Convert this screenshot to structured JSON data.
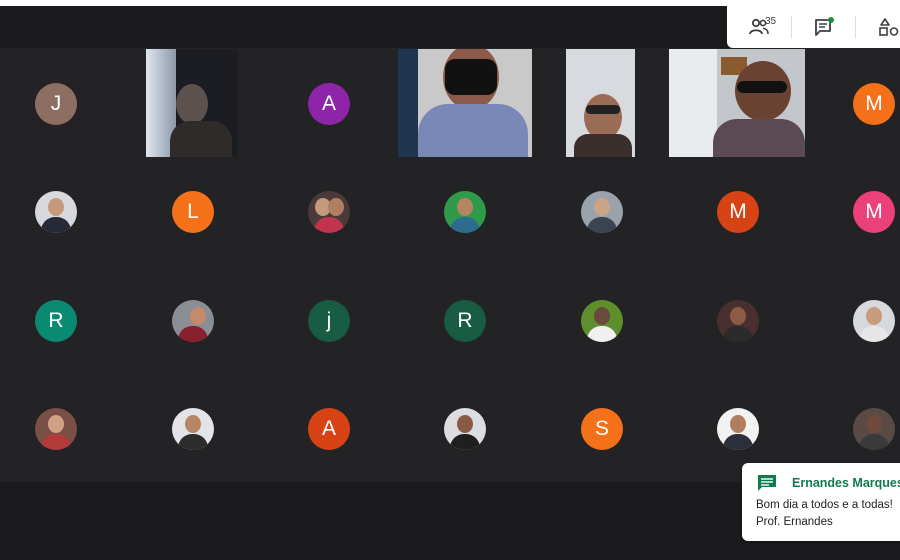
{
  "toolbar": {
    "participants_count": "35",
    "icons": [
      "people-icon",
      "chat-icon",
      "activities-icon"
    ]
  },
  "participants": {
    "row1": [
      {
        "kind": "avatar",
        "initial": "J",
        "color": "#8d6e63"
      },
      {
        "kind": "video"
      },
      {
        "kind": "avatar",
        "initial": "A",
        "color": "#8e24aa"
      },
      {
        "kind": "video"
      },
      {
        "kind": "video"
      },
      {
        "kind": "video"
      },
      {
        "kind": "avatar",
        "initial": "M",
        "color": "#f4711a"
      }
    ],
    "row2": [
      {
        "kind": "photo"
      },
      {
        "kind": "avatar",
        "initial": "L",
        "color": "#f4711a"
      },
      {
        "kind": "photo"
      },
      {
        "kind": "photo"
      },
      {
        "kind": "photo"
      },
      {
        "kind": "avatar",
        "initial": "M",
        "color": "#d84315"
      },
      {
        "kind": "avatar",
        "initial": "M",
        "color": "#ec407a"
      }
    ],
    "row3": [
      {
        "kind": "avatar",
        "initial": "R",
        "color": "#0b8a73"
      },
      {
        "kind": "photo"
      },
      {
        "kind": "avatar",
        "initial": "j",
        "color": "#185c43"
      },
      {
        "kind": "avatar",
        "initial": "R",
        "color": "#185c43"
      },
      {
        "kind": "photo"
      },
      {
        "kind": "photo"
      },
      {
        "kind": "photo"
      }
    ],
    "row4": [
      {
        "kind": "photo"
      },
      {
        "kind": "photo"
      },
      {
        "kind": "avatar",
        "initial": "A",
        "color": "#d84315"
      },
      {
        "kind": "photo"
      },
      {
        "kind": "avatar",
        "initial": "S",
        "color": "#f4711a"
      },
      {
        "kind": "photo"
      },
      {
        "kind": "photo"
      }
    ]
  },
  "chat_notification": {
    "sender": "Ernandes Marques",
    "message_line1": "Bom dia a todos e a todas!",
    "message_line2": "Prof. Ernandes",
    "accent": "#137a4f"
  },
  "colors": {
    "background": "#202124",
    "grid": "#232326"
  }
}
